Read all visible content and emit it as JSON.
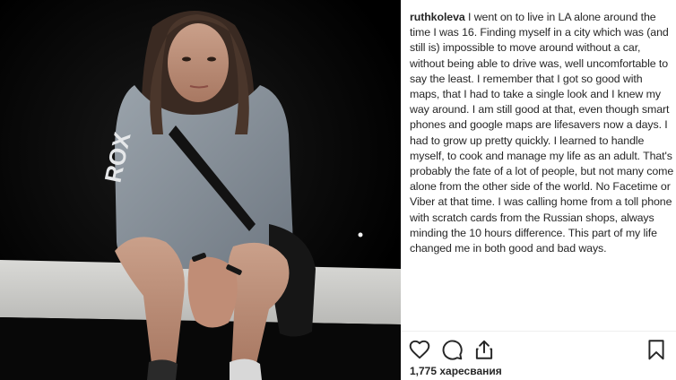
{
  "post": {
    "username": "ruthkoleva",
    "caption": "I went on to live in LA alone around the time I was 16. Finding myself in a city which was (and still is) impossible to move around without a car, without being able to drive was, well uncomfortable to say the least. I remember that I got so good with maps, that I had to take a single look and I knew my way around. I am still good at that, even though smart phones and google maps are lifesavers now a days. I had to grow up pretty quickly. I learned to handle myself, to cook and manage my life as an adult. That's probably the fate of a lot of people, but not many come alone from the other side of the world. No Facetime or Viber at that time. I was calling home from a toll phone with scratch cards from the Russian shops, always minding the 10 hours difference. This part of my life changed me in both good and bad ways.",
    "likes_text": "1,775 харесвания"
  },
  "photo": {
    "description_icon": "photo-of-woman-sitting-at-night",
    "sweatshirt_print": "ROX"
  },
  "actions": {
    "like_icon": "heart-icon",
    "comment_icon": "comment-icon",
    "share_icon": "share-icon",
    "save_icon": "bookmark-icon"
  },
  "colors": {
    "text": "#262626",
    "background": "#ffffff",
    "border": "#efefef"
  }
}
